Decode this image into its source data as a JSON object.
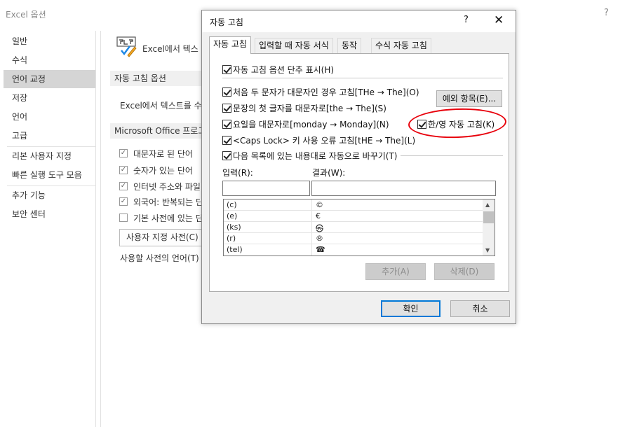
{
  "background": {
    "title": "Excel 옵션",
    "help": "?",
    "nav": [
      "일반",
      "수식",
      "언어 교정",
      "저장",
      "언어",
      "고급",
      "리본 사용자 지정",
      "빠른 실행 도구 모음",
      "추가 기능",
      "보안 센터"
    ],
    "header_text": "Excel에서 텍스",
    "section1": "자동 고침 옵션",
    "section1_text": "Excel에서 텍스트를 수",
    "section2": "Microsoft Office 프로그",
    "checks": [
      "대문자로 된 단어",
      "숫자가 있는 단어",
      "인터넷 주소와 파일",
      "외국어: 반복되는 단",
      "기본 사전에 있는 단"
    ],
    "custom_dict_button": "사용자 지정 사전(C)",
    "dict_lang": "사용할 사전의 언어(T)"
  },
  "dialog": {
    "title": "자동 고침",
    "help": "?",
    "close": "✕",
    "tabs": [
      "자동 고침",
      "입력할 때 자동 서식",
      "동작",
      "수식 자동 고침"
    ],
    "show_buttons": "자동 고침 옵션 단추 표시(H)",
    "opt_two_caps": "처음 두 문자가 대문자인 경우 고침[THe → The](O)",
    "opt_sentence": "문장의 첫 글자를 대문자로[the → The](S)",
    "opt_days": "요일을 대문자로[monday → Monday](N)",
    "opt_capslock": "<Caps Lock> 키 사용 오류 고침[tHE → The](L)",
    "opt_replace": "다음 목록에 있는 내용대로 자동으로 바꾸기(T)",
    "opt_hanyeong": "한/영 자동 고침(K)",
    "exceptions_button": "예외 항목(E)...",
    "input_label": "입력(R):",
    "result_label": "결과(W):",
    "input_value": "",
    "result_value": "",
    "entries": [
      {
        "from": "(c)",
        "to": "©"
      },
      {
        "from": "(e)",
        "to": "€"
      },
      {
        "from": "(ks)",
        "to": "㉿"
      },
      {
        "from": "(r)",
        "to": "®"
      },
      {
        "from": "(tel)",
        "to": "☎"
      }
    ],
    "add_button": "추가(A)",
    "delete_button": "삭제(D)",
    "ok_button": "확인",
    "cancel_button": "취소"
  },
  "colors": {
    "highlight": "#e8000b",
    "accent": "#0078d7"
  }
}
